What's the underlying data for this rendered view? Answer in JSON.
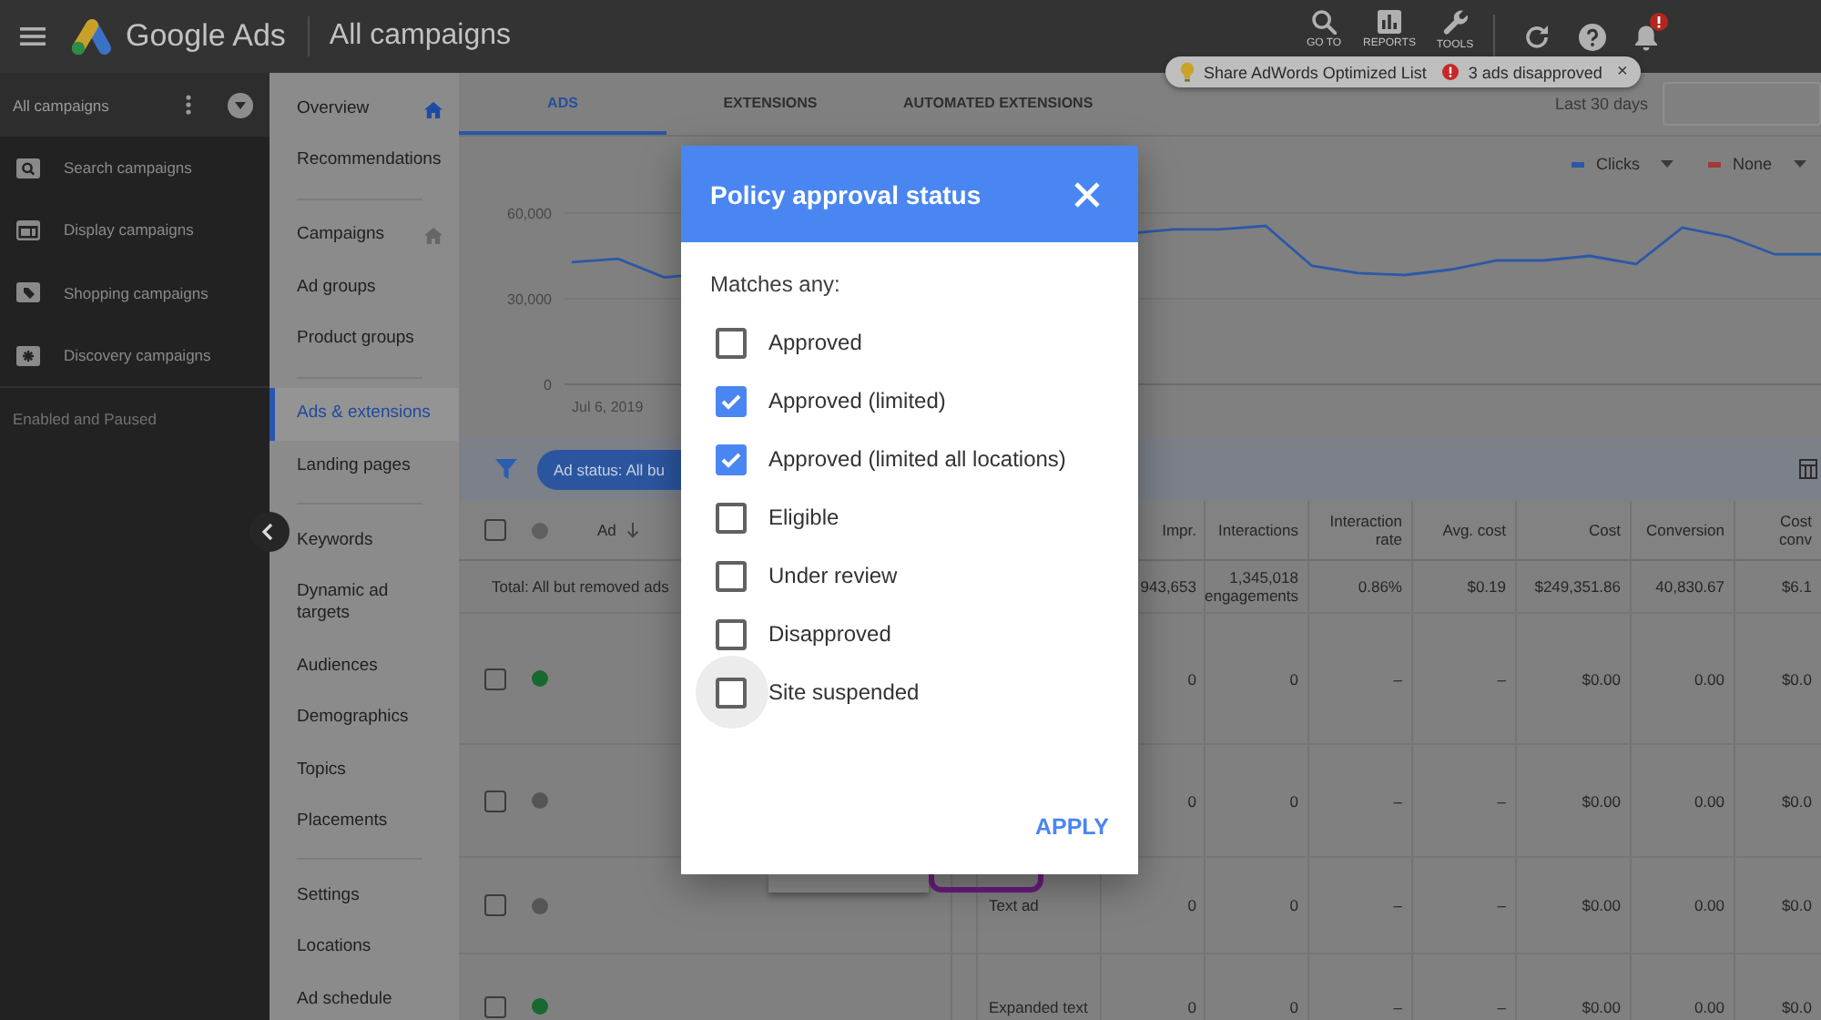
{
  "top_bar": {
    "product": "Google Ads",
    "page_title": "All campaigns",
    "tools": [
      "GO TO",
      "REPORTS",
      "TOOLS"
    ]
  },
  "notice": {
    "items": [
      "Share AdWords Optimized List",
      "3 ads disapproved"
    ],
    "dismiss": "×"
  },
  "campaign_panel": {
    "title": "All campaigns",
    "items": [
      "Search campaigns",
      "Display campaigns",
      "Shopping campaigns",
      "Discovery campaigns"
    ],
    "filter": "Enabled and Paused"
  },
  "nav": {
    "groups": [
      [
        {
          "label": "Overview",
          "selected": false,
          "home": {
            "active": true
          }
        },
        {
          "label": "Recommendations",
          "selected": false
        }
      ],
      [
        {
          "label": "Campaigns",
          "selected": false,
          "home": {
            "active": false
          }
        },
        {
          "label": "Ad groups",
          "selected": false
        },
        {
          "label": "Product groups",
          "selected": false
        }
      ],
      [
        {
          "label": "Ads & extensions",
          "selected": true
        },
        {
          "label": "Landing pages",
          "selected": false
        }
      ],
      [
        {
          "label": "Keywords",
          "selected": false
        },
        {
          "label": "Dynamic ad targets",
          "selected": false
        },
        {
          "label": "Audiences",
          "selected": false
        },
        {
          "label": "Demographics",
          "selected": false
        },
        {
          "label": "Topics",
          "selected": false
        },
        {
          "label": "Placements",
          "selected": false
        }
      ],
      [
        {
          "label": "Settings",
          "selected": false
        },
        {
          "label": "Locations",
          "selected": false
        },
        {
          "label": "Ad schedule",
          "selected": false
        }
      ]
    ]
  },
  "tabs": [
    {
      "label": "ADS",
      "selected": true
    },
    {
      "label": "EXTENSIONS",
      "selected": false
    },
    {
      "label": "AUTOMATED EXTENSIONS",
      "selected": false
    }
  ],
  "date_range": {
    "label": "Last 30 days"
  },
  "chart": {
    "comparison": {
      "label": "None",
      "color": "#a33a3a"
    },
    "date_label": "Jul 6, 2019",
    "chart_data": {
      "type": "line",
      "ylim": [
        0,
        60000
      ],
      "yticks": [
        {
          "value": 0,
          "label": "0"
        },
        {
          "value": 30000,
          "label": "30,000"
        },
        {
          "value": 60000,
          "label": "60,000"
        }
      ],
      "series": [
        {
          "name": "Clicks",
          "color": "#2b58a8",
          "values": [
            42800,
            44000,
            37500,
            null,
            null,
            null,
            null,
            null,
            null,
            null,
            null,
            null,
            null,
            54300,
            54300,
            55500,
            41500,
            39000,
            38300,
            40200,
            43400,
            43400,
            45000,
            42100,
            54900,
            51700,
            45600,
            45600
          ]
        }
      ]
    }
  },
  "filter_bar": {
    "chips": [
      "Ad status: All bu"
    ]
  },
  "table": {
    "header_checkbox": {
      "checked": false
    },
    "columns": [
      {
        "label": "Ad",
        "sorted": true
      },
      {
        "label": "Impr.",
        "sorted": false
      },
      {
        "label": "Interactions",
        "sorted": false
      },
      {
        "label": "Interaction rate",
        "sorted": false
      },
      {
        "label": "Avg. cost",
        "sorted": false
      },
      {
        "label": "Cost",
        "sorted": false
      },
      {
        "label": "Conversion",
        "sorted": false
      },
      {
        "label": "Cost conv",
        "sorted": false
      }
    ],
    "total": {
      "label": "Total: All but removed ads",
      "values": [
        "943,653",
        "1,345,018 engagements",
        "0.86%",
        "$0.19",
        "$249,351.86",
        "40,830.67",
        "$6.1"
      ]
    },
    "rows": [
      {
        "checked": false,
        "color": "#17692f",
        "values": [
          "0",
          "0",
          "–",
          "–",
          "$0.00",
          "0.00",
          "$0.0"
        ]
      },
      {
        "checked": false,
        "color": "#555555",
        "values": [
          "0",
          "0",
          "–",
          "–",
          "$0.00",
          "0.00",
          "$0.0"
        ]
      },
      {
        "checked": false,
        "color": "#555555",
        "ad_type": "Text ad",
        "values": [
          "0",
          "0",
          "–",
          "–",
          "$0.00",
          "0.00",
          "$0.0"
        ]
      },
      {
        "checked": false,
        "color": "#17692f",
        "ad_type": "Expanded text",
        "values": [
          "0",
          "0",
          "–",
          "–",
          "$0.00",
          "0.00",
          "$0.0"
        ]
      }
    ]
  },
  "policy_dialog": {
    "title": "Policy approval status",
    "match_label": "Matches any:",
    "options": [
      {
        "label": "Approved",
        "checked": false,
        "focused": false
      },
      {
        "label": "Approved (limited)",
        "checked": true,
        "focused": false
      },
      {
        "label": "Approved (limited all locations)",
        "checked": true,
        "focused": false
      },
      {
        "label": "Eligible",
        "checked": false,
        "focused": false
      },
      {
        "label": "Under review",
        "checked": false,
        "focused": false
      },
      {
        "label": "Disapproved",
        "checked": false,
        "focused": false
      },
      {
        "label": "Site suspended",
        "checked": false,
        "focused": true
      }
    ],
    "action": "APPLY"
  }
}
